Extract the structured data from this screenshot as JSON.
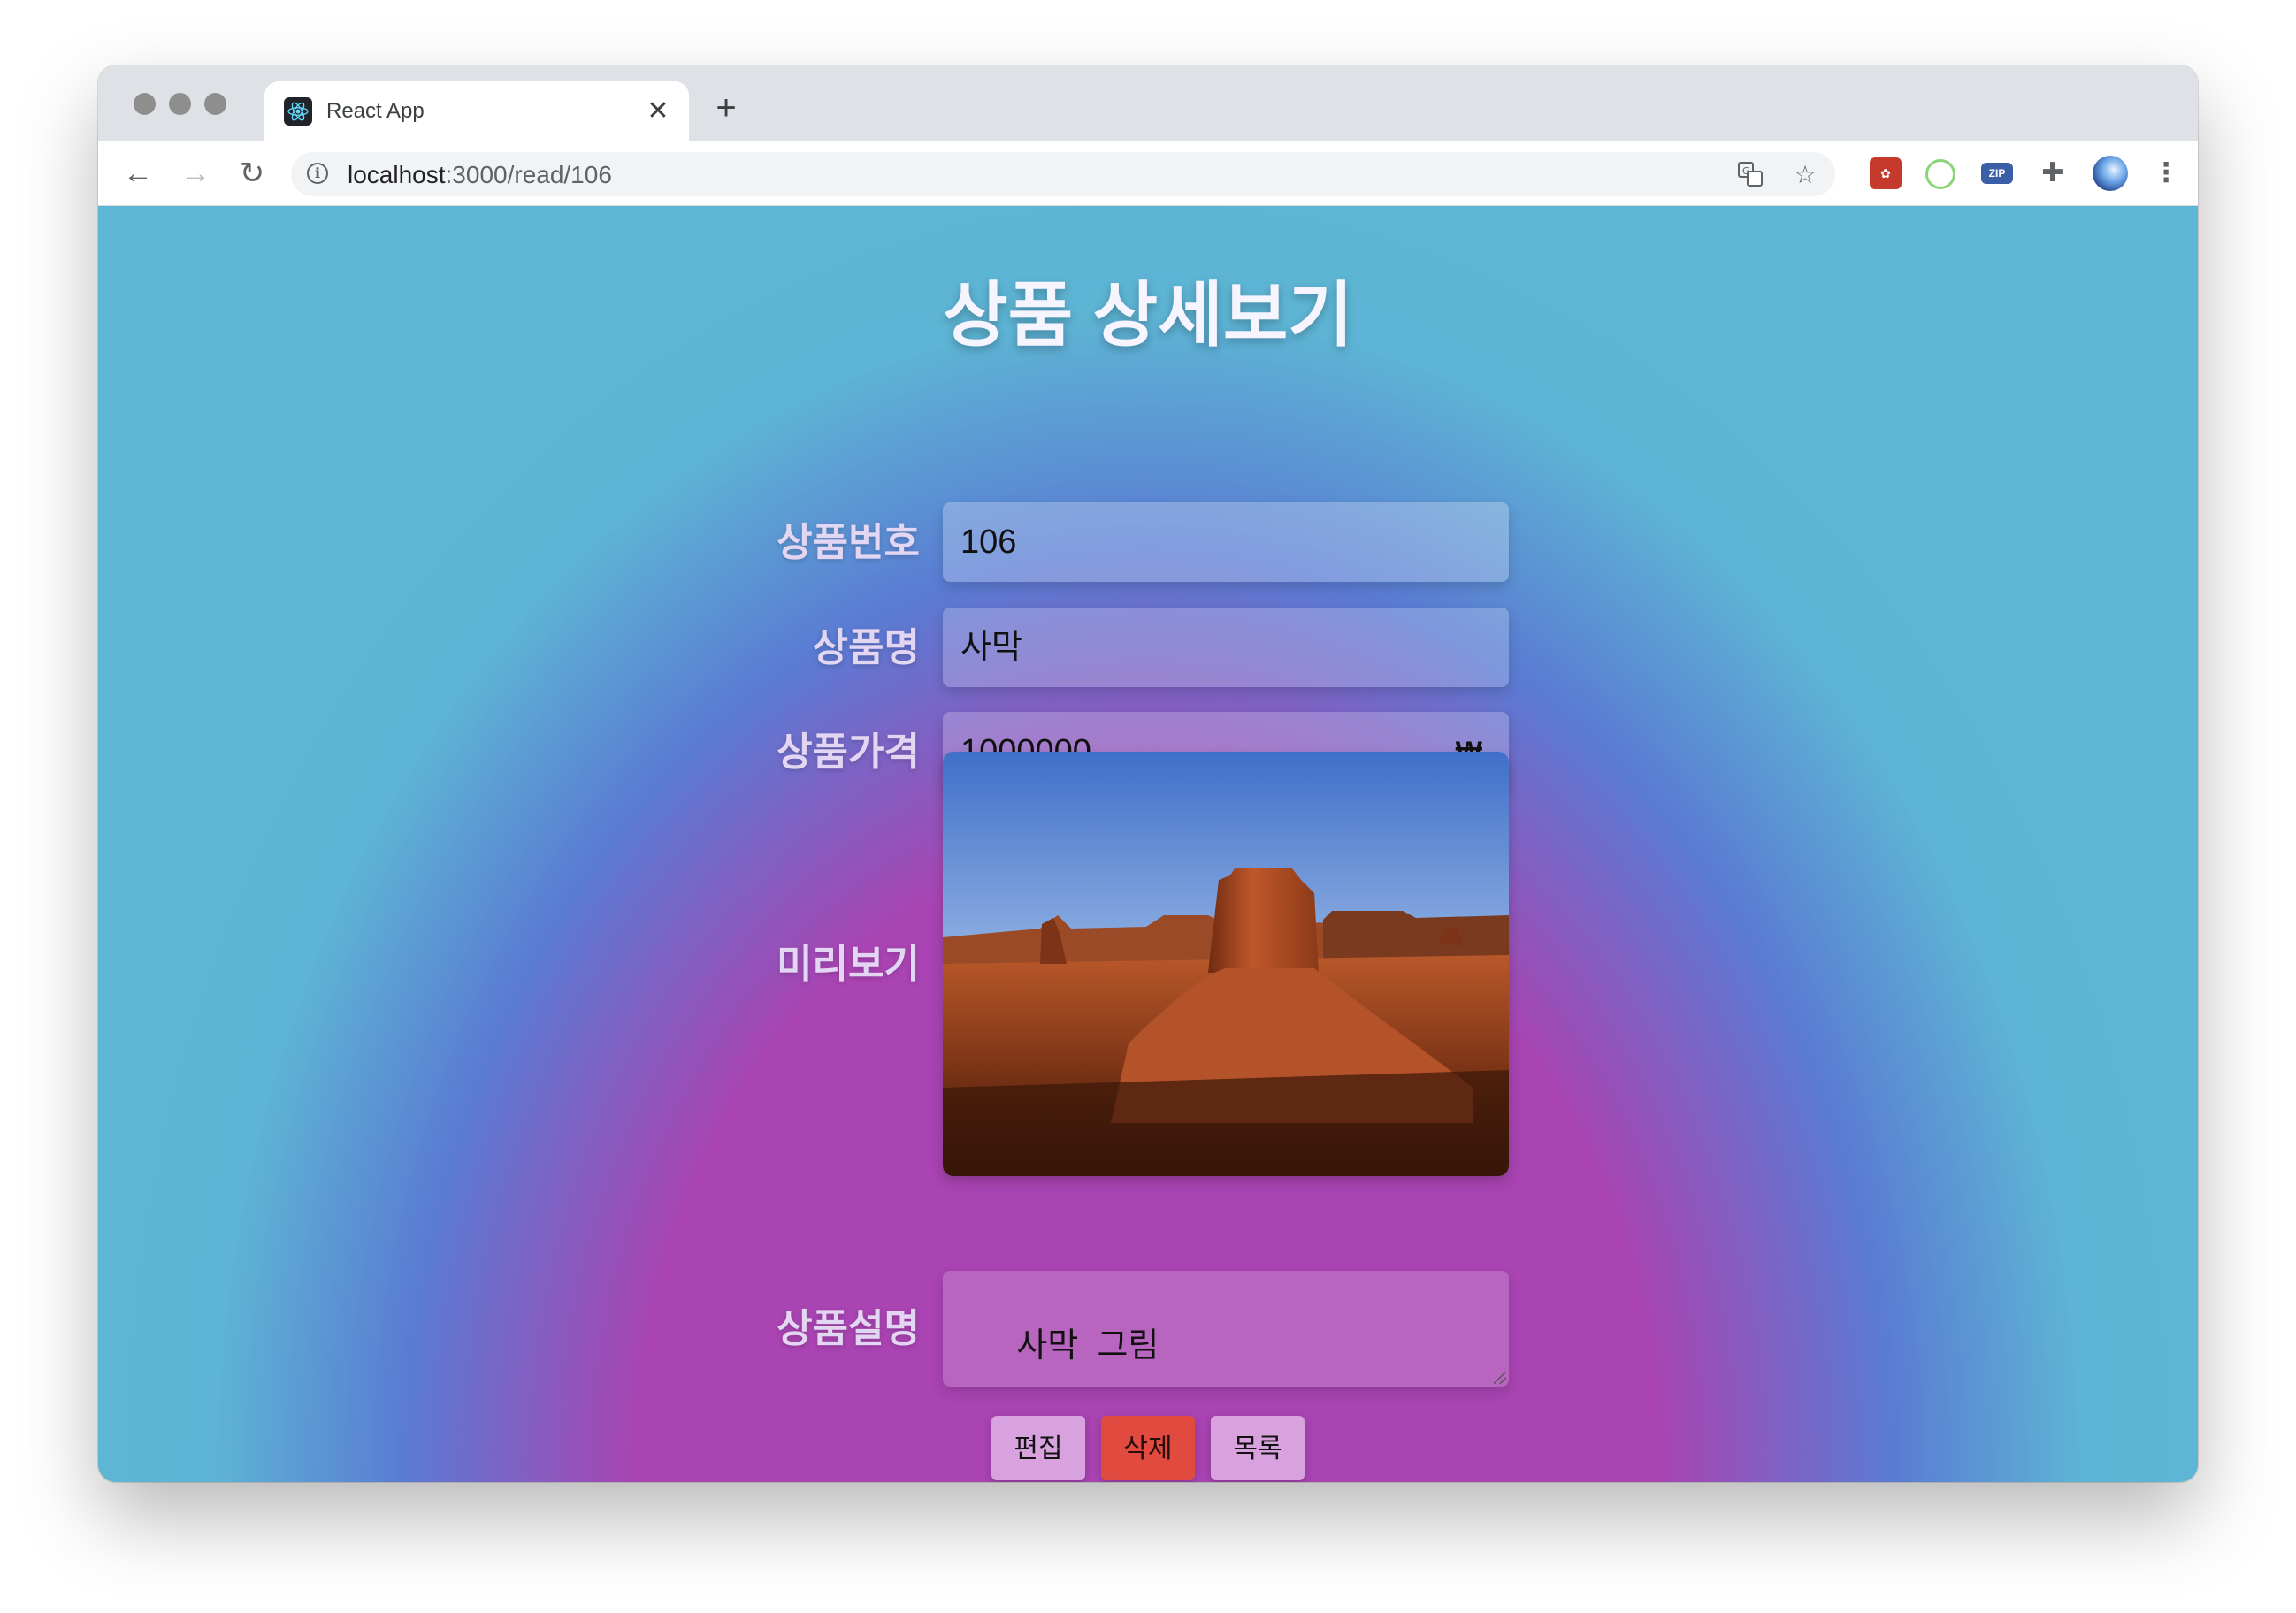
{
  "browser": {
    "tab_title": "React App",
    "tab_close": "✕",
    "new_tab": "+",
    "url_host": "localhost",
    "url_path": ":3000/read/106",
    "back": "←",
    "forward": "→",
    "reload": "↻",
    "extensions": [
      "translate-icon",
      "star-icon",
      "ext-red-icon",
      "ext-ring-icon",
      "ext-zip-icon",
      "puzzle-icon",
      "profile-avatar",
      "menu-kebab-icon"
    ],
    "zip_label": "ZIP"
  },
  "page": {
    "title": "상품 상세보기",
    "fields": {
      "id_label": "상품번호",
      "id_value": "106",
      "name_label": "상품명",
      "name_value": "사막",
      "price_label": "상품가격",
      "price_value": "1000000",
      "currency": "₩",
      "preview_label": "미리보기",
      "desc_label": "상품설명",
      "desc_value": "사막  그림"
    },
    "buttons": {
      "edit": "편집",
      "delete": "삭제",
      "list": "목록"
    }
  },
  "colors": {
    "background_center": "#a944b2",
    "background_mid": "#5a7bd3",
    "background_edge": "#5db6d3",
    "delete_button": "#e14b3f",
    "light_button": "#d7a2dd"
  }
}
